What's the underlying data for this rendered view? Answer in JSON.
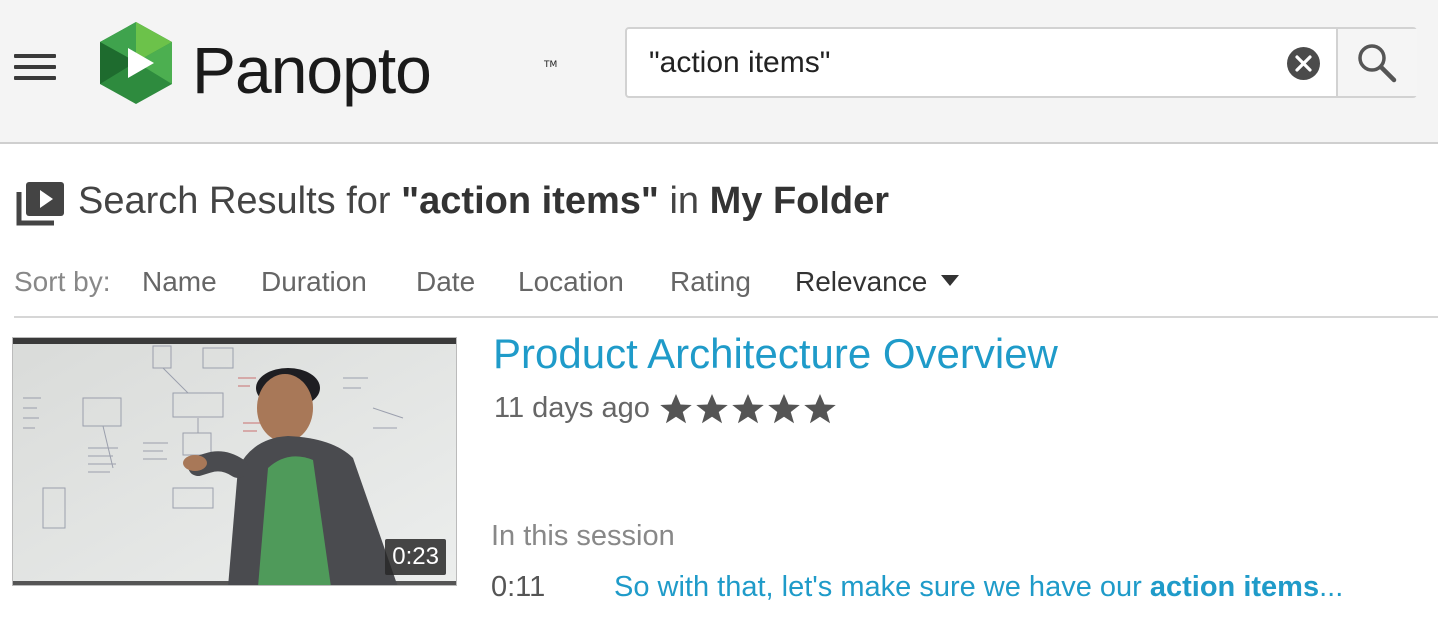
{
  "header": {
    "menu_icon": "hamburger-menu-icon",
    "logo_text": "Panopto",
    "logo_tm": "TM",
    "logo_colors": [
      "#2e8b3e",
      "#5cb85c",
      "#1e6b2e"
    ]
  },
  "search": {
    "value": "\"action items\"",
    "clear_icon": "clear-circle-icon",
    "search_icon": "magnifier-icon"
  },
  "results_heading": {
    "icon": "video-library-icon",
    "prefix": "Search Results for ",
    "query": "\"action items\"",
    "middle": " in ",
    "folder": "My Folder"
  },
  "sort": {
    "label": "Sort by:",
    "options": [
      "Name",
      "Duration",
      "Date",
      "Location",
      "Rating",
      "Relevance"
    ],
    "active": "Relevance"
  },
  "result": {
    "title": "Product Architecture Overview",
    "age": "11 days ago",
    "rating": 5,
    "rating_max": 5,
    "duration": "0:23",
    "in_session_label": "In this session",
    "hit_time": "0:11",
    "hit_text_before": "So with that, let's make sure we have our ",
    "hit_text_match": "action items",
    "hit_text_after": "..."
  },
  "colors": {
    "accent": "#1f9bc9",
    "header_bg": "#f4f4f4"
  }
}
